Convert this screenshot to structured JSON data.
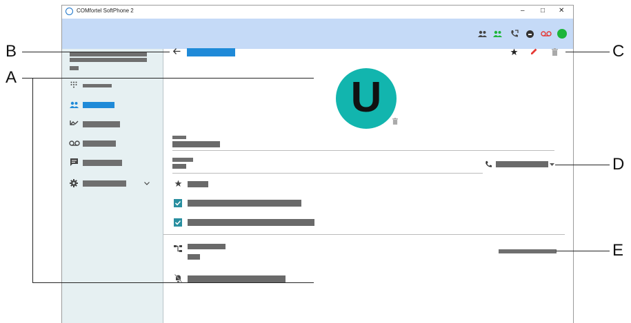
{
  "window": {
    "title": "COMfortel SoftPhone 2",
    "controls": {
      "minimize": "–",
      "maximize": "□",
      "close": "✕"
    }
  },
  "toolbar": {
    "icons": [
      "contacts-icon",
      "contacts-green-icon",
      "call-forward-icon",
      "do-not-disturb-icon",
      "voicemail-icon",
      "status-online-icon"
    ],
    "accent_green": "#1db53a",
    "voicemail_red": "#e53935"
  },
  "sidebar": {
    "items": [
      {
        "icon": "dialpad-icon",
        "active": false
      },
      {
        "icon": "contacts-icon",
        "active": true
      },
      {
        "icon": "call-history-icon",
        "active": false
      },
      {
        "icon": "voicemail-icon",
        "active": false
      },
      {
        "icon": "chat-icon",
        "active": false
      },
      {
        "icon": "settings-icon",
        "active": false,
        "expandable": true
      }
    ],
    "active_color": "#1f8ad8"
  },
  "contact": {
    "avatar_letter": "U",
    "avatar_color": "#12b5ae"
  },
  "callouts": {
    "A": "A",
    "B": "B",
    "C": "C",
    "D": "D",
    "E": "E"
  }
}
